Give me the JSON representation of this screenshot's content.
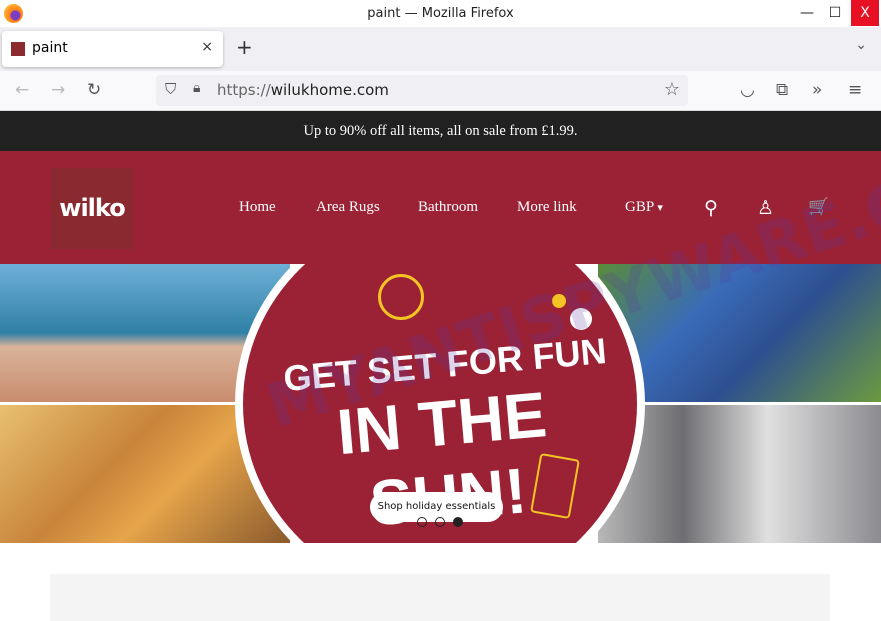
{
  "window": {
    "title": "paint — Mozilla Firefox",
    "minimize": "—",
    "maximize": "☐",
    "close": "X"
  },
  "tab": {
    "label": "paint",
    "close": "×",
    "new_tab": "+",
    "list_all": "⌄"
  },
  "nav": {
    "back": "←",
    "forward": "→",
    "reload": "↻",
    "url_scheme": "https://",
    "url_host": "wilukhome.com",
    "star": "☆",
    "pocket": "◡",
    "extensions": "⧉",
    "more": "»",
    "menu": "≡"
  },
  "promo": {
    "text": "Up to 90% off all items, all on sale from £1.99."
  },
  "header": {
    "logo": "wilko",
    "links": [
      "Home",
      "Area Rugs",
      "Bathroom",
      "More link"
    ],
    "currency": "GBP",
    "currency_caret": "▾",
    "search": "⚲",
    "account": "♙",
    "cart": "🛒"
  },
  "hero": {
    "line1": "GET SET FOR FUN",
    "line2": "IN THE SUN!",
    "button": "Shop holiday essentials",
    "slides": 3,
    "active_slide": 3
  },
  "colors": {
    "brand": "#9b2135",
    "promo_bg": "#212121",
    "accent_yellow": "#f4c324"
  },
  "watermark": "MYANTISPYWARE.COM"
}
